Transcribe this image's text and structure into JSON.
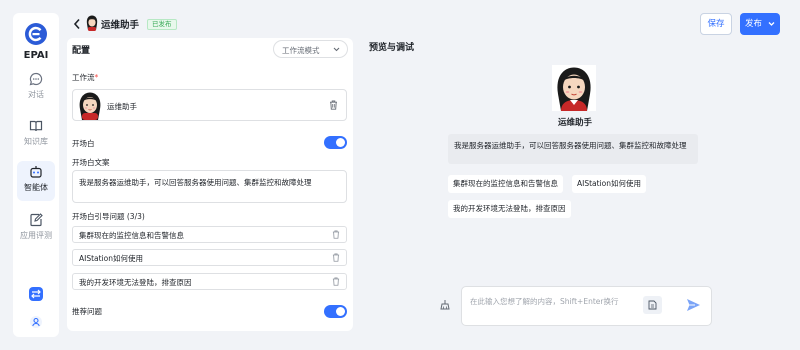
{
  "app": {
    "brand": "EPAI"
  },
  "nav": {
    "items": [
      {
        "label": "对话",
        "icon": "chat-bubble-icon"
      },
      {
        "label": "知识库",
        "icon": "book-icon"
      },
      {
        "label": "智能体",
        "icon": "robot-icon",
        "active": true
      },
      {
        "label": "应用评测",
        "icon": "edit-note-icon"
      }
    ],
    "bottom_icons": [
      "swap-arrows-icon",
      "user-icon"
    ]
  },
  "header": {
    "title": "运维助手",
    "status": "已发布",
    "save_label": "保存",
    "publish_label": "发布"
  },
  "config": {
    "heading": "配置",
    "mode": "工作流模式",
    "workflow_label": "工作流",
    "workflow_required_mark": "*",
    "workflow_name": "运维助手",
    "opening_label": "开场白",
    "opening_enabled": true,
    "opening_text_label": "开场白文案",
    "opening_text": "我是服务器运维助手，可以回答服务器使用问题、集群监控和故障处理",
    "guide_label": "开场白引导问题 (3/3)",
    "guide_questions": [
      "集群现在的监控信息和告警信息",
      "AIStation如何使用",
      "我的开发环境无法登陆，排查原因"
    ],
    "recommend_label": "推荐问题",
    "recommend_enabled": true
  },
  "preview": {
    "heading": "预览与调试",
    "bot_name": "运维助手",
    "intro": "我是服务器运维助手，可以回答服务器使用问题、集群监控和故障处理",
    "chips": [
      "集群现在的监控信息和告警信息",
      "AIStation如何使用",
      "我的开发环境无法登陆，排查原因"
    ],
    "input_placeholder": "在此输入您想了解的内容，Shift+Enter换行"
  },
  "colors": {
    "accent": "#3370ff",
    "badge_green": "#34a853",
    "required": "#f54a45"
  }
}
